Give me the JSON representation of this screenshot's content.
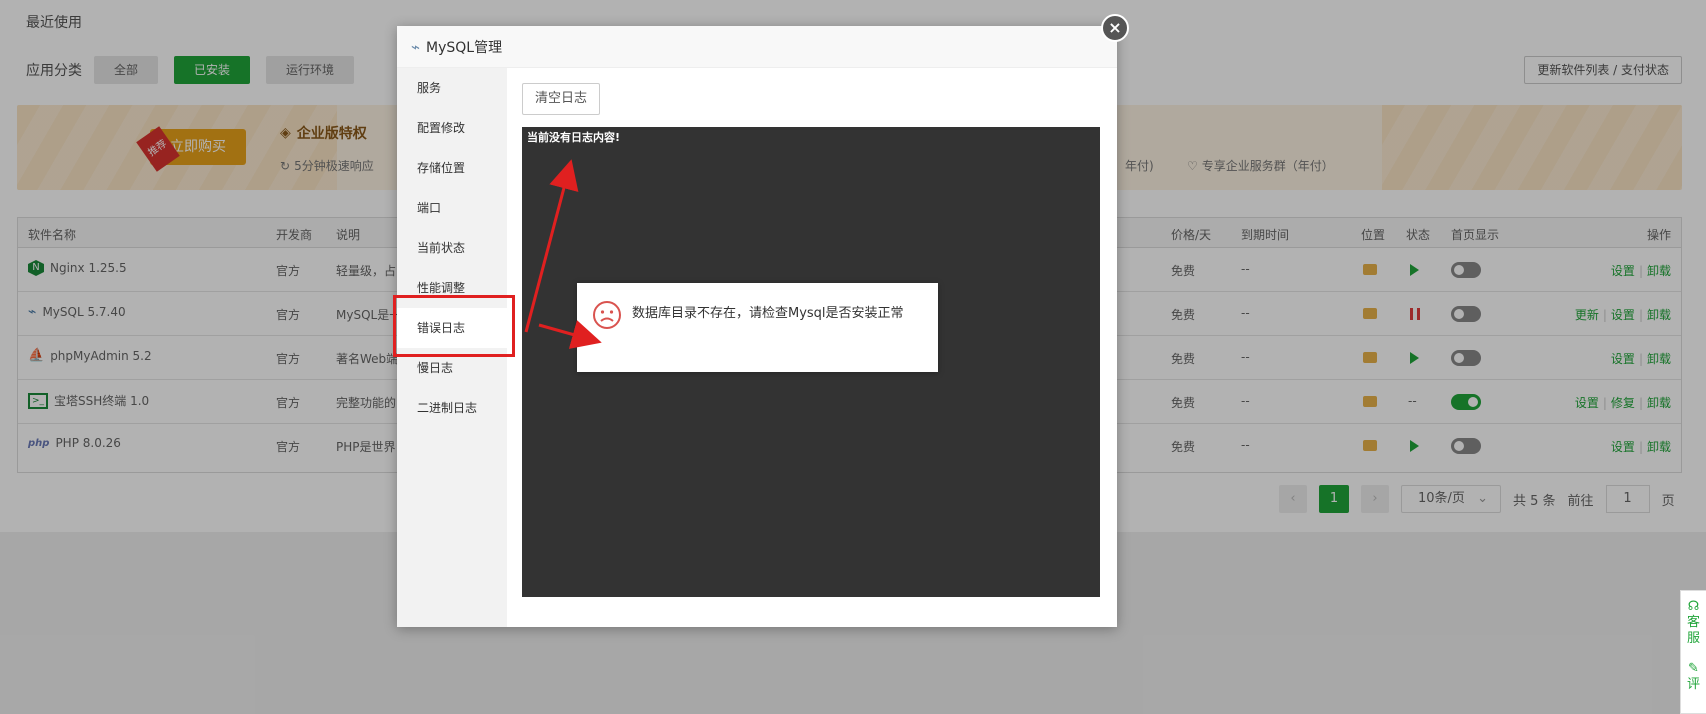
{
  "page": {
    "recent_title": "最近使用",
    "category_label": "应用分类",
    "categories": [
      "全部",
      "已安装",
      "运行环境"
    ],
    "update_btn": "更新软件列表 / 支付状态"
  },
  "banner": {
    "buy_label": "立即购买",
    "buy_tag": "推荐",
    "ent_title": "企业版特权",
    "item1": "5分钟极速响应",
    "item2": "年付)",
    "item3": "专享企业服务群（年付）"
  },
  "table": {
    "headers": [
      "软件名称",
      "开发商",
      "说明",
      "价格/天",
      "到期时间",
      "位置",
      "状态",
      "首页显示",
      "操作"
    ],
    "rows": [
      {
        "name": "Nginx 1.25.5",
        "dev": "官方",
        "desc": "轻量级，占",
        "price": "免费",
        "expire": "--",
        "ops": [
          "设置",
          "卸载"
        ]
      },
      {
        "name": "MySQL 5.7.40",
        "dev": "官方",
        "desc": "MySQL是一",
        "price": "免费",
        "expire": "--",
        "ops": [
          "更新",
          "设置",
          "卸载"
        ]
      },
      {
        "name": "phpMyAdmin 5.2",
        "dev": "官方",
        "desc": "著名Web端",
        "price": "免费",
        "expire": "--",
        "ops": [
          "设置",
          "卸载"
        ]
      },
      {
        "name": "宝塔SSH终端 1.0",
        "dev": "官方",
        "desc": "完整功能的",
        "price": "免费",
        "expire": "--",
        "status": "--",
        "ops": [
          "设置",
          "修复",
          "卸载"
        ]
      },
      {
        "name": "PHP 8.0.26",
        "dev": "官方",
        "desc": "PHP是世界",
        "price": "免费",
        "expire": "--",
        "ops": [
          "设置",
          "卸载"
        ]
      }
    ]
  },
  "pager": {
    "current": "1",
    "page_size": "10条/页",
    "total": "共 5 条",
    "goto_label": "前往",
    "goto_value": "1",
    "page_suffix": "页"
  },
  "side_tools": {
    "service": "客服",
    "review": "评"
  },
  "modal": {
    "title": "MySQL管理",
    "menu": [
      "服务",
      "配置修改",
      "存储位置",
      "端口",
      "当前状态",
      "性能调整",
      "错误日志",
      "慢日志",
      "二进制日志"
    ],
    "active_index": 6,
    "clear_btn": "清空日志",
    "log_text": "当前没有日志内容!",
    "close": "×"
  },
  "message": {
    "text": "数据库目录不存在，请检查Mysql是否安装正常"
  },
  "colors": {
    "accent": "#20a53a",
    "highlight": "#e02020"
  }
}
